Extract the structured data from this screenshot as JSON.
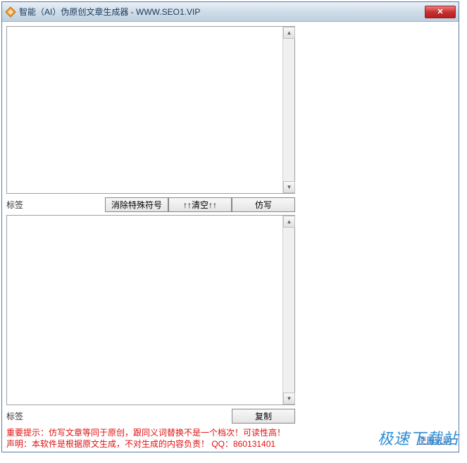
{
  "window": {
    "title": "智能（AI）伪原创文章生成器 - WWW.SEO1.VIP",
    "close_symbol": "✕"
  },
  "top_section": {
    "label": "标签",
    "textarea_value": "",
    "buttons": {
      "remove_special": "消除特殊符号",
      "clear": "↑↑清空↑↑",
      "rewrite": "仿写"
    }
  },
  "bottom_section": {
    "label": "标签",
    "textarea_value": "",
    "buttons": {
      "copy": "复制"
    }
  },
  "footer": {
    "line1": "重要提示：仿写文章等同于原创，跟同义词替换不是一个档次！可读性高！",
    "line2": "声明：本软件是根据原文生成，不对生成的内容负责！  QQ：860131401"
  },
  "right_panel": {
    "usage_link": "使用说明"
  },
  "watermark": "极速下载站",
  "scrollbar": {
    "up_arrow": "▲",
    "down_arrow": "▼"
  }
}
